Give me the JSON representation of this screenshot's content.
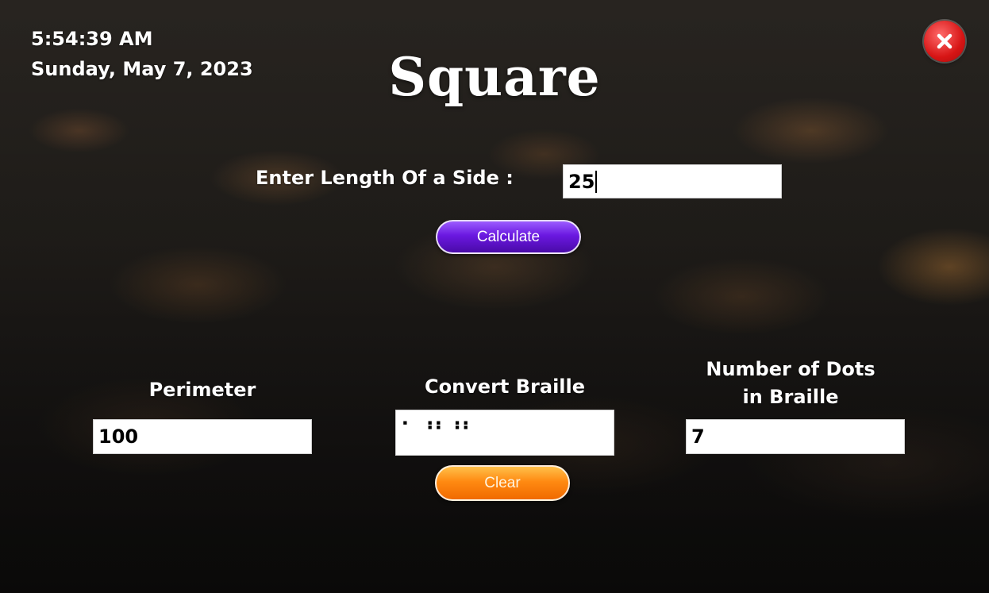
{
  "clock": {
    "time": "5:54:39 AM",
    "date": "Sunday, May 7, 2023"
  },
  "title": "Square",
  "close": {
    "icon": "close-icon",
    "color": "#d71515"
  },
  "input": {
    "label": "Enter Length Of a Side :",
    "value": "25"
  },
  "buttons": {
    "calculate": "Calculate",
    "clear": "Clear"
  },
  "results": {
    "perimeter": {
      "label": "Perimeter",
      "value": "100"
    },
    "braille": {
      "label": "Convert Braille",
      "value": "⠂ ⠰⠆⠰⠆"
    },
    "dots": {
      "label_line1": "Number of Dots",
      "label_line2": "in Braille",
      "value": "7"
    }
  },
  "colors": {
    "calculate_button": "#6a18e0",
    "clear_button": "#ff8a12"
  }
}
